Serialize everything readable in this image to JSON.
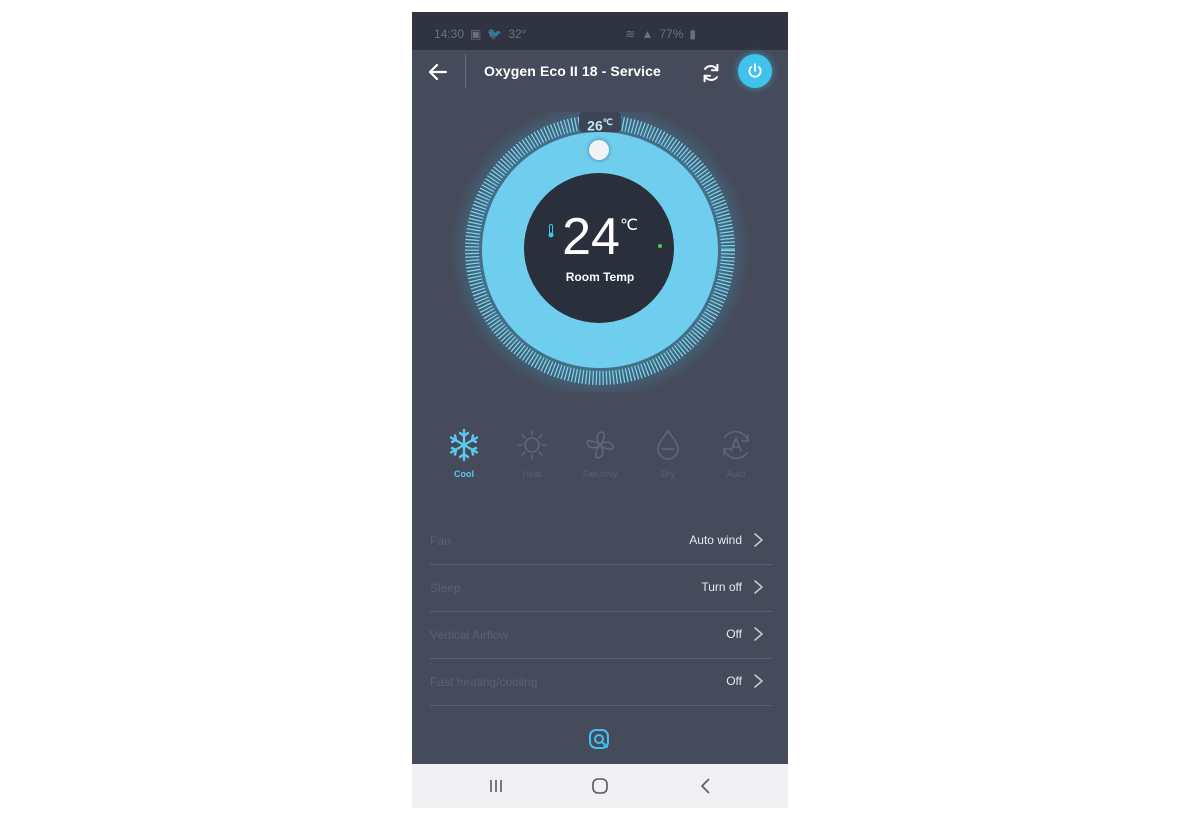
{
  "statusbar": {
    "time": "14:30",
    "temp": "32°",
    "battery": "77%"
  },
  "header": {
    "title": "Oxygen Eco II 18 - Service"
  },
  "dial": {
    "setpoint": "26",
    "setpoint_unit": "℃",
    "room_temp": "24",
    "room_unit": "℃",
    "room_label": "Room Temp"
  },
  "modes": [
    {
      "label": "Cool",
      "icon": "snowflake-icon",
      "active": true
    },
    {
      "label": "Heat",
      "icon": "sun-icon",
      "active": false
    },
    {
      "label": "Fan only",
      "icon": "fan-icon",
      "active": false
    },
    {
      "label": "Dry",
      "icon": "droplet-icon",
      "active": false
    },
    {
      "label": "Auto",
      "icon": "auto-icon",
      "active": false
    }
  ],
  "settings": [
    {
      "label": "Fan",
      "value": "Auto wind"
    },
    {
      "label": "Sleep",
      "value": "Turn off"
    },
    {
      "label": "Vertical Airflow",
      "value": "Off"
    },
    {
      "label": "Fast heating/cooling",
      "value": "Off"
    }
  ],
  "colors": {
    "accent": "#3fc2ec",
    "background": "#454b5b",
    "dial_inner": "#2a2f3c"
  }
}
